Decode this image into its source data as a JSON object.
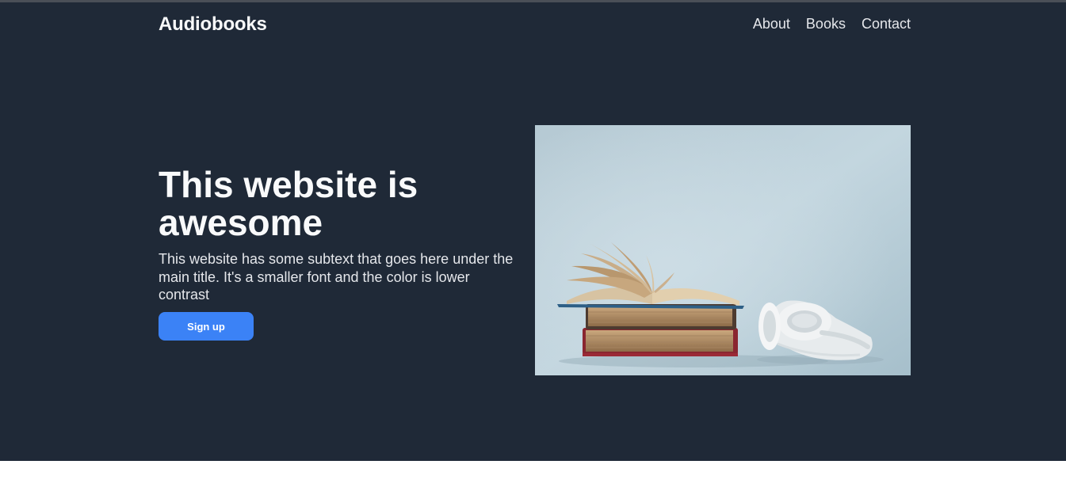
{
  "header": {
    "brand": "Audiobooks",
    "nav": [
      {
        "label": "About"
      },
      {
        "label": "Books"
      },
      {
        "label": "Contact"
      }
    ]
  },
  "hero": {
    "title": "This website is awesome",
    "subtitle": "This website has some subtext that goes here under the main title. It's a smaller font and the color is lower contrast",
    "cta_label": "Sign up",
    "image_icon": "books-and-headphones-illustration"
  },
  "colors": {
    "hero_background": "#1f2937",
    "heading_text": "#f9fafb",
    "body_text": "#e5e7eb",
    "accent": "#3b82f6",
    "page_background": "#ffffff"
  }
}
